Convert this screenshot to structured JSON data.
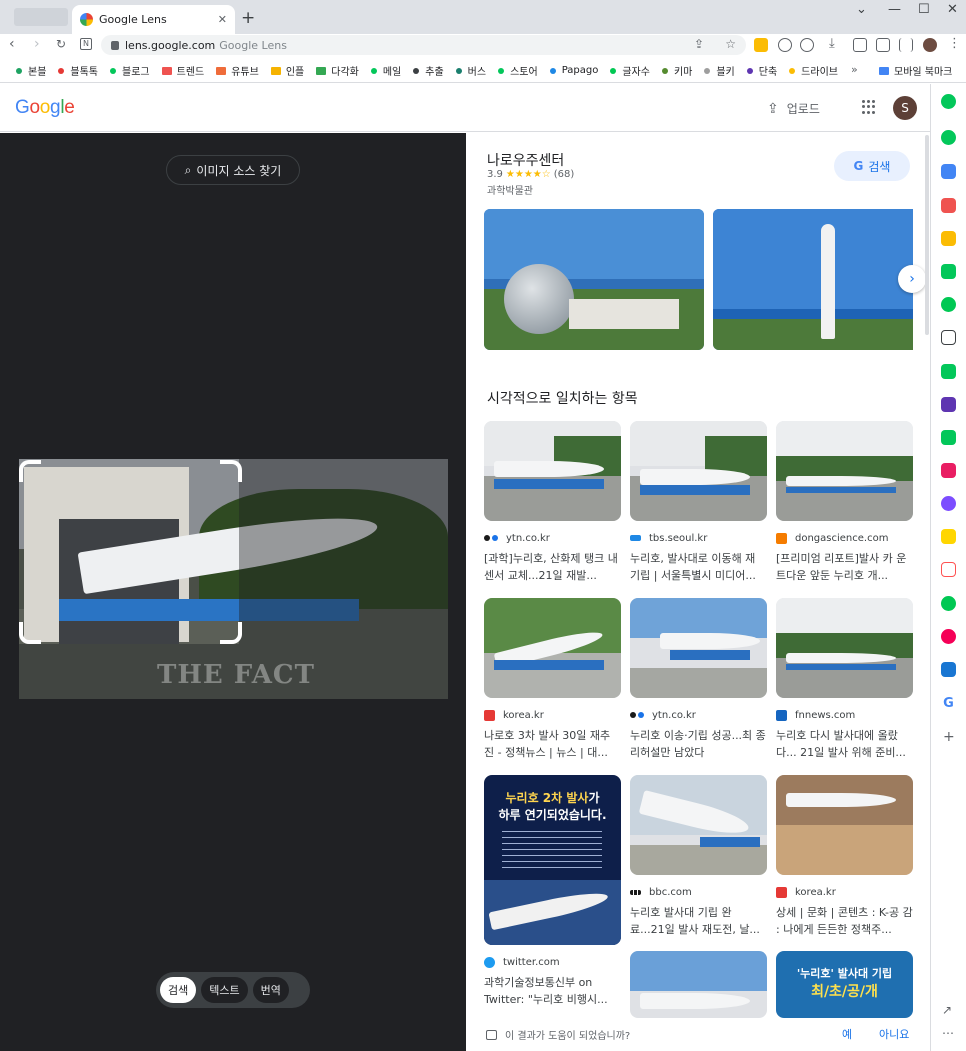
{
  "browser": {
    "tab_title": "Google Lens",
    "url_domain": "lens.google.com",
    "url_page_title": "Google Lens",
    "new_tab": "+",
    "minimize": "—",
    "maximize": "☐",
    "close": "✕",
    "tab_close": "✕",
    "menu": "⋮"
  },
  "bookmarks": [
    {
      "label": "본블",
      "color": "#1ea362",
      "type": "dot"
    },
    {
      "label": "블톡톡",
      "color": "#e53935",
      "type": "dot"
    },
    {
      "label": "블로그",
      "color": "#03c75a",
      "type": "dot"
    },
    {
      "label": "트렌드",
      "color": "#ef5350",
      "type": "folder"
    },
    {
      "label": "유튜브",
      "color": "#ef6c3a",
      "type": "folder"
    },
    {
      "label": "인플",
      "color": "#f6b300",
      "type": "folder"
    },
    {
      "label": "다각화",
      "color": "#34a853",
      "type": "folder"
    },
    {
      "label": "메일",
      "color": "#03c75a",
      "type": "dot"
    },
    {
      "label": "추출",
      "color": "#3c4043",
      "type": "dot"
    },
    {
      "label": "버스",
      "color": "#1a7f6e",
      "type": "dot"
    },
    {
      "label": "스토어",
      "color": "#03c75a",
      "type": "dot"
    },
    {
      "label": "Papago",
      "color": "#1e88e5",
      "type": "dot"
    },
    {
      "label": "글자수",
      "color": "#00c853",
      "type": "dot"
    },
    {
      "label": "키마",
      "color": "#558b2f",
      "type": "dot"
    },
    {
      "label": "블키",
      "color": "#9e9e9e",
      "type": "dot"
    },
    {
      "label": "단축",
      "color": "#5e35b1",
      "type": "dot"
    },
    {
      "label": "드라이브",
      "color": "#fbbc04",
      "type": "dot"
    }
  ],
  "bookmarks_more": "»",
  "bookmarks_mobile": "모바일 북마크",
  "header": {
    "logo_letters": [
      {
        "ch": "G",
        "color": "#4285f4"
      },
      {
        "ch": "o",
        "color": "#ea4335"
      },
      {
        "ch": "o",
        "color": "#fbbc04"
      },
      {
        "ch": "g",
        "color": "#4285f4"
      },
      {
        "ch": "l",
        "color": "#34a853"
      },
      {
        "ch": "e",
        "color": "#ea4335"
      }
    ],
    "upload_label": "업로드",
    "avatar_initial": "S"
  },
  "left": {
    "find_source_label": "이미지 소스 찾기",
    "watermark": "THE FACT",
    "modes": [
      {
        "label": "검색",
        "selected": true
      },
      {
        "label": "텍스트",
        "selected": false
      },
      {
        "label": "번역",
        "selected": false
      }
    ]
  },
  "place": {
    "name": "나로우주센터",
    "rating": "3.9",
    "stars": "★★★★☆",
    "reviews": "(68)",
    "category": "과학박물관",
    "search_label": "검색"
  },
  "visual_matches": {
    "title": "시각적으로 일치하는 항목",
    "items": [
      {
        "source": "ytn.co.kr",
        "title": "[과학]누리호, 산화제 탱크 내 센서 교체...21일 재발...",
        "icon_color": "#1a1a1a"
      },
      {
        "source": "tbs.seoul.kr",
        "title": "누리호, 발사대로 이동해 재 기립 | 서울특별시 미디어...",
        "icon_color": "#1e88e5"
      },
      {
        "source": "dongascience.com",
        "title": "[프리미엄 리포트]발사 카 운트다운 앞둔 누리호 개...",
        "icon_color": "#f57c00"
      },
      {
        "source": "korea.kr",
        "title": "나로호 3차 발사 30일 재추 진 - 정책뉴스 | 뉴스 | 대...",
        "icon_color": "#e53935"
      },
      {
        "source": "ytn.co.kr",
        "title": "누리호 이송·기립 성공...최 종 리허설만 남았다",
        "icon_color": "#1a1a1a"
      },
      {
        "source": "fnnews.com",
        "title": "누리호 다시 발사대에 올랐 다... 21일 발사 위해 준비...",
        "icon_color": "#1565c0"
      },
      {
        "source": "twitter.com",
        "title": "과학기술정보통신부 on Twitter: \"누리호 비행시...",
        "icon_color": "#1d9bf0"
      },
      {
        "source": "bbc.com",
        "title": "누리호 발사대 기립 완 료...21일 발사 재도전, 날...",
        "icon_color": "#1a1a1a"
      },
      {
        "source": "korea.kr",
        "title": "상세 | 문화 | 콘텐츠 : K-공 감 : 나에게 든든한 정책주...",
        "icon_color": "#e53935"
      }
    ],
    "poster_line1_a": "누리호 2차 발사",
    "poster_line1_b": "가",
    "poster_line2": "하루 연기되었습니다.",
    "poster2_line1": "'누리호' 발사대 기립",
    "poster2_line2": "최/초/공/개"
  },
  "feedback": {
    "question": "이 결과가 도움이 되었습니까?",
    "yes": "예",
    "no": "아니요"
  },
  "sidebar_colors": [
    "#03c75a",
    "#03c75a",
    "#4285f4",
    "#ef5350",
    "#fbbc04",
    "#03c75a",
    "#00c853",
    "#3c4043",
    "#03c75a",
    "#5e35b1",
    "#03c75a",
    "#e91e63",
    "#7c4dff",
    "#ffd600",
    "#ff5252",
    "#00c853",
    "#f50057",
    "#1976d2",
    "#4285f4"
  ]
}
